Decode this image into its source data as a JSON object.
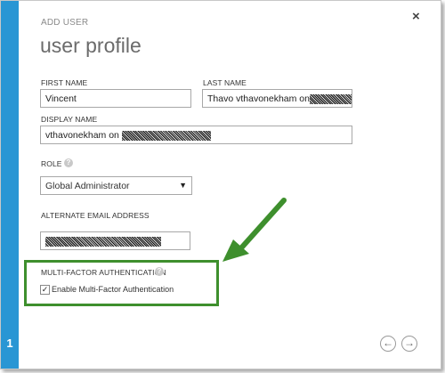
{
  "header": {
    "eyebrow": "ADD USER",
    "title": "user profile",
    "close_glyph": "×"
  },
  "form": {
    "first_name_label": "FIRST NAME",
    "first_name_value": "Vincent",
    "last_name_label": "LAST NAME",
    "last_name_value": "Thavo vthavonekham on",
    "display_name_label": "DISPLAY NAME",
    "display_name_value": "vthavonekham on",
    "role_label": "ROLE",
    "role_value": "Global Administrator",
    "alt_email_label": "ALTERNATE EMAIL ADDRESS",
    "mfa_label": "MULTI-FACTOR AUTHENTICATION",
    "mfa_checkbox_label": "Enable Multi-Factor Authentication",
    "mfa_checked": true
  },
  "wizard": {
    "step": "1",
    "prev_glyph": "←",
    "next_glyph": "→"
  },
  "colors": {
    "step_bar": "#2996d4",
    "highlight": "#3e8f2d"
  },
  "icons": {
    "help": "question-circle",
    "close": "x",
    "dropdown": "triangle-down",
    "annotation": "green-arrow"
  }
}
